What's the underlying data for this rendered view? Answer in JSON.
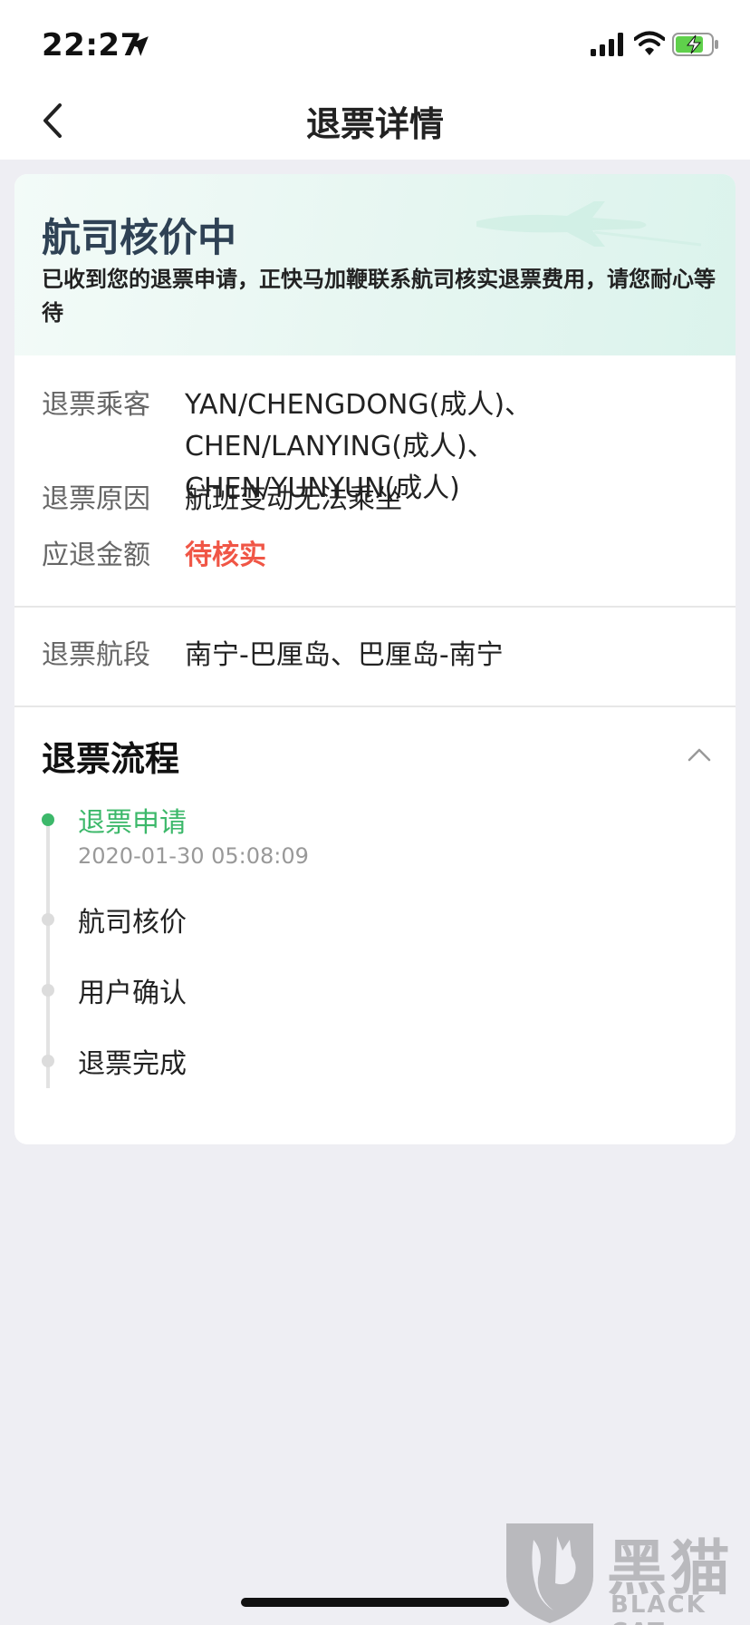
{
  "status_bar": {
    "time": "22:27",
    "icons": [
      "location-arrow-icon",
      "signal-icon",
      "wifi-icon",
      "battery-charging-icon"
    ]
  },
  "nav": {
    "title": "退票详情",
    "back_icon": "chevron-left-icon"
  },
  "status_card": {
    "title": "航司核价中",
    "description": "已收到您的退票申请，正快马加鞭联系航司核实退票费用，请您耐心等待",
    "decor_icon": "airplane-icon"
  },
  "details": {
    "passengers_label": "退票乘客",
    "passengers_value": "YAN/CHENGDONG(成人)、CHEN/LANYING(成人)、CHEN/YUNYUN(成人)",
    "reason_label": "退票原因",
    "reason_value": "航班变动无法乘坐",
    "amount_label": "应退金额",
    "amount_value": "待核实",
    "segment_label": "退票航段",
    "segment_value": "南宁-巴厘岛、巴厘岛-南宁"
  },
  "flow": {
    "title": "退票流程",
    "collapse_icon": "chevron-up-icon",
    "steps": [
      {
        "label": "退票申请",
        "time": "2020-01-30 05:08:09",
        "active": true
      },
      {
        "label": "航司核价",
        "active": false
      },
      {
        "label": "用户确认",
        "active": false
      },
      {
        "label": "退票完成",
        "active": false
      }
    ]
  },
  "watermark": {
    "brand": "黑猫",
    "sub": "BLACK CAT"
  },
  "colors": {
    "accent_green": "#3cb86a",
    "alert_red": "#f05646",
    "title_navy": "#2f4255",
    "page_bg": "#eeeef3"
  }
}
